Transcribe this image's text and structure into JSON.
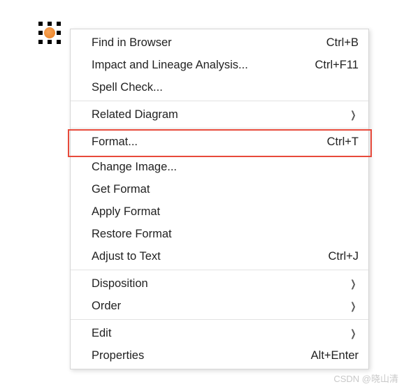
{
  "colors": {
    "highlight": "#e74a3b",
    "accent": "#e87c1c"
  },
  "canvas_object_icon": "orange-circle",
  "menu": {
    "group1": [
      {
        "label": "Find in Browser",
        "accel": "Ctrl+B"
      },
      {
        "label": "Impact and Lineage Analysis...",
        "accel": "Ctrl+F11"
      },
      {
        "label": "Spell Check...",
        "accel": ""
      }
    ],
    "group2": [
      {
        "label": "Related Diagram",
        "submenu": true
      }
    ],
    "group3_highlight": {
      "label": "Format...",
      "accel": "Ctrl+T"
    },
    "group3": [
      {
        "label": "Change Image...",
        "accel": ""
      },
      {
        "label": "Get Format",
        "accel": ""
      },
      {
        "label": "Apply Format",
        "accel": ""
      },
      {
        "label": "Restore Format",
        "accel": ""
      },
      {
        "label": "Adjust to Text",
        "accel": "Ctrl+J"
      }
    ],
    "group4": [
      {
        "label": "Disposition",
        "submenu": true
      },
      {
        "label": "Order",
        "submenu": true
      }
    ],
    "group5": [
      {
        "label": "Edit",
        "submenu": true
      },
      {
        "label": "Properties",
        "accel": "Alt+Enter"
      }
    ]
  },
  "watermark": "CSDN @晓山清"
}
